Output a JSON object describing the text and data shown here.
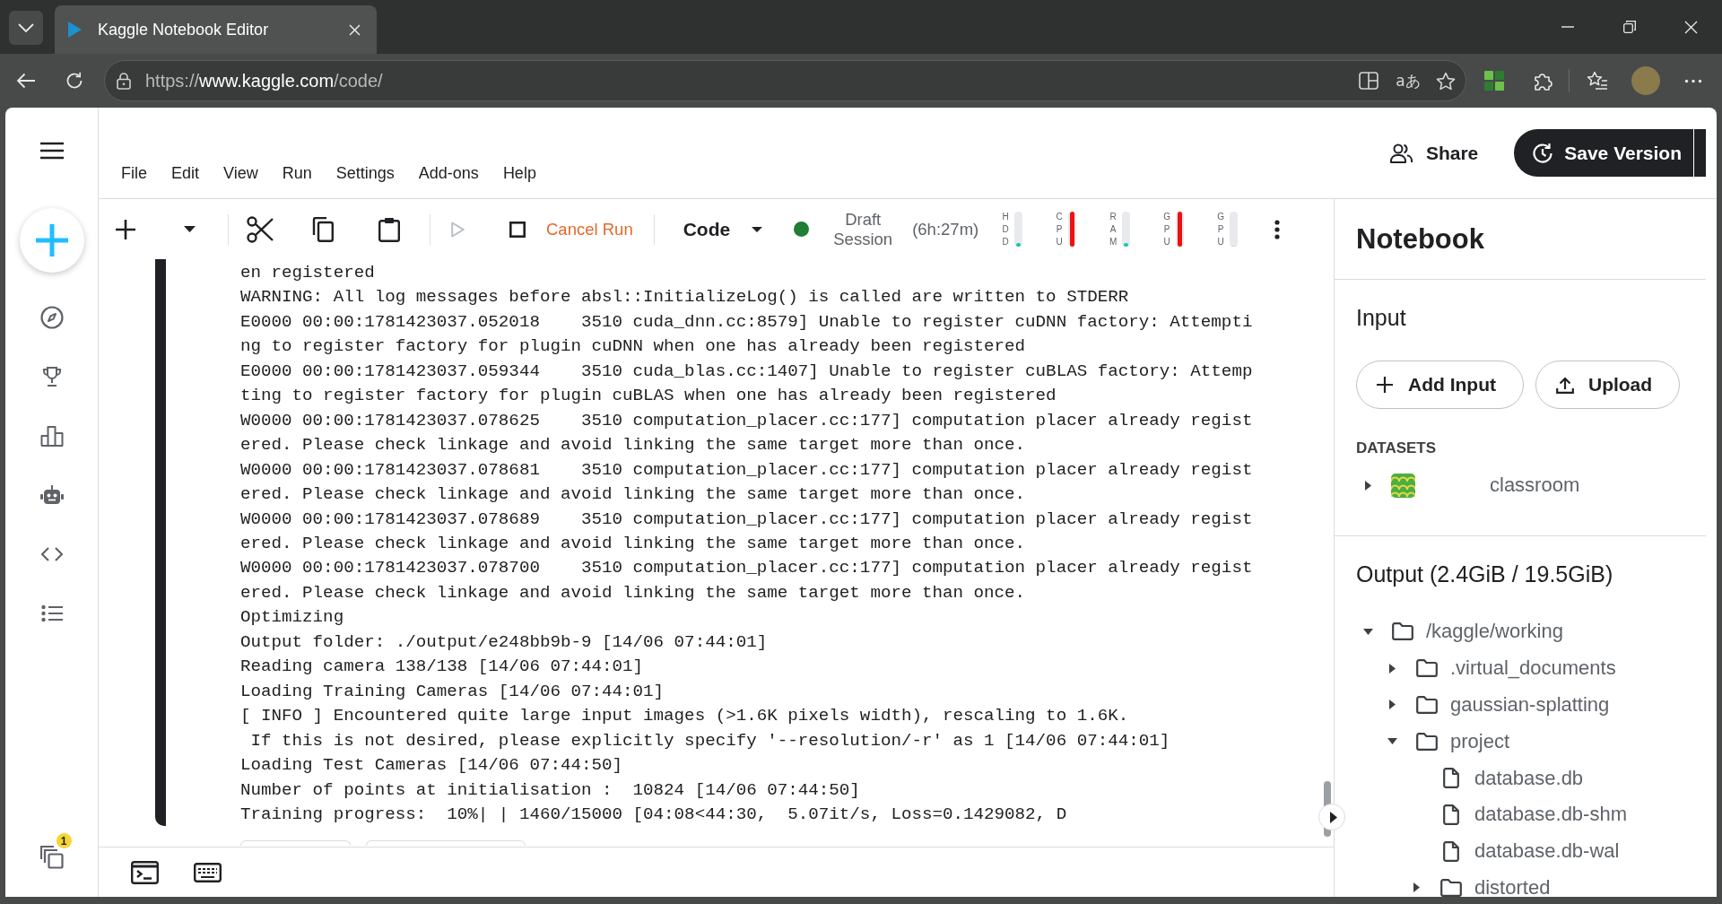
{
  "browser": {
    "tab_title": "Kaggle Notebook Editor",
    "url": {
      "scheme": "https://",
      "host": "www.kaggle.com",
      "path": "/code/"
    },
    "translate_glyph": "aあ"
  },
  "header": {
    "menu": [
      "File",
      "Edit",
      "View",
      "Run",
      "Settings",
      "Add-ons",
      "Help"
    ],
    "share": "Share",
    "save": "Save Version"
  },
  "sidebar": {
    "badge": "1"
  },
  "toolbar": {
    "run_disabled": true,
    "cancel": "Cancel Run",
    "cell_type": "Code",
    "session_running": true,
    "session": "Draft Session",
    "session_time": "(6h:27m)",
    "meters": [
      {
        "label": "HDD",
        "level": 0.1
      },
      {
        "label": "CPU",
        "level": 1
      },
      {
        "label": "RAM",
        "level": 0.1
      },
      {
        "label": "GPU",
        "level": 1
      },
      {
        "label": "GPU",
        "level": 0
      }
    ]
  },
  "console": {
    "lines": [
      "en registered",
      "WARNING: All log messages before absl::InitializeLog() is called are written to STDERR",
      "E0000 00:00:1781423037.052018    3510 cuda_dnn.cc:8579] Unable to register cuDNN factory: Attempti",
      "ng to register factory for plugin cuDNN when one has already been registered",
      "E0000 00:00:1781423037.059344    3510 cuda_blas.cc:1407] Unable to register cuBLAS factory: Attemp",
      "ting to register factory for plugin cuBLAS when one has already been registered",
      "W0000 00:00:1781423037.078625    3510 computation_placer.cc:177] computation placer already regist",
      "ered. Please check linkage and avoid linking the same target more than once.",
      "W0000 00:00:1781423037.078681    3510 computation_placer.cc:177] computation placer already regist",
      "ered. Please check linkage and avoid linking the same target more than once.",
      "W0000 00:00:1781423037.078689    3510 computation_placer.cc:177] computation placer already regist",
      "ered. Please check linkage and avoid linking the same target more than once.",
      "W0000 00:00:1781423037.078700    3510 computation_placer.cc:177] computation placer already regist",
      "ered. Please check linkage and avoid linking the same target more than once.",
      "Optimizing",
      "Output folder: ./output/e248bb9b-9 [14/06 07:44:01]",
      "Reading camera 138/138 [14/06 07:44:01]",
      "Loading Training Cameras [14/06 07:44:01]",
      "[ INFO ] Encountered quite large input images (>1.6K pixels width), rescaling to 1.6K.",
      " If this is not desired, please explicitly specify '--resolution/-r' as 1 [14/06 07:44:01]",
      "Loading Test Cameras [14/06 07:44:50]",
      "Number of points at initialisation :  10824 [14/06 07:44:50]",
      "Training progress:  10%| | 1460/15000 [04:08<44:30,  5.07it/s, Loss=0.1429082, D"
    ]
  },
  "panel": {
    "title": "Notebook",
    "input": {
      "title": "Input",
      "add": "Add Input",
      "upload": "Upload"
    },
    "datasets": {
      "heading": "DATASETS",
      "items": [
        {
          "name": "classroom",
          "expanded": false
        }
      ]
    },
    "output": {
      "title": "Output (2.4GiB / 19.5GiB)",
      "tree": [
        {
          "name": "/kaggle/working",
          "kind": "folder",
          "expanded": true,
          "children": [
            {
              "name": ".virtual_documents",
              "kind": "folder",
              "expanded": false
            },
            {
              "name": "gaussian-splatting",
              "kind": "folder",
              "expanded": false
            },
            {
              "name": "project",
              "kind": "folder",
              "expanded": true,
              "children": [
                {
                  "name": "database.db",
                  "kind": "file"
                },
                {
                  "name": "database.db-shm",
                  "kind": "file"
                },
                {
                  "name": "database.db-wal",
                  "kind": "file"
                },
                {
                  "name": "distorted",
                  "kind": "folder",
                  "expanded": false
                }
              ]
            }
          ]
        }
      ]
    }
  }
}
